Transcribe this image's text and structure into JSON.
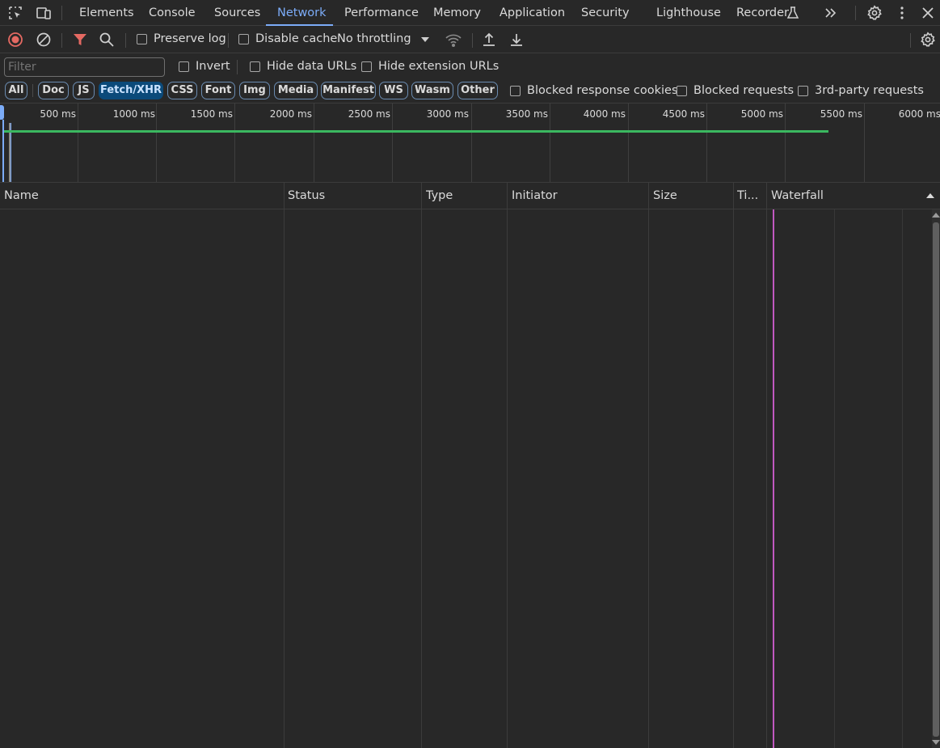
{
  "tabs": [
    {
      "label": "Elements"
    },
    {
      "label": "Console"
    },
    {
      "label": "Sources"
    },
    {
      "label": "Network",
      "active": true
    },
    {
      "label": "Performance"
    },
    {
      "label": "Memory"
    },
    {
      "label": "Application"
    },
    {
      "label": "Security"
    },
    {
      "label": "Lighthouse"
    },
    {
      "label": "Recorder"
    }
  ],
  "toolbar": {
    "preserve_log": "Preserve log",
    "disable_cache": "Disable cache",
    "throttling": "No throttling"
  },
  "filter": {
    "placeholder": "Filter",
    "invert": "Invert",
    "hide_data_urls": "Hide data URLs",
    "hide_extension_urls": "Hide extension URLs"
  },
  "type_filters": [
    {
      "label": "All"
    },
    {
      "label": "Doc"
    },
    {
      "label": "JS"
    },
    {
      "label": "Fetch/XHR",
      "active": true
    },
    {
      "label": "CSS"
    },
    {
      "label": "Font"
    },
    {
      "label": "Img"
    },
    {
      "label": "Media"
    },
    {
      "label": "Manifest"
    },
    {
      "label": "WS"
    },
    {
      "label": "Wasm"
    },
    {
      "label": "Other"
    }
  ],
  "extra_filters": {
    "blocked_cookies": "Blocked response cookies",
    "blocked_requests": "Blocked requests",
    "third_party": "3rd-party requests"
  },
  "overview": {
    "ticks": [
      "500 ms",
      "1000 ms",
      "1500 ms",
      "2000 ms",
      "2500 ms",
      "3000 ms",
      "3500 ms",
      "4000 ms",
      "4500 ms",
      "5000 ms",
      "5500 ms",
      "6000 ms"
    ]
  },
  "columns": {
    "name": "Name",
    "status": "Status",
    "type": "Type",
    "initiator": "Initiator",
    "size": "Size",
    "time": "Ti...",
    "waterfall": "Waterfall"
  },
  "colors": {
    "accent": "#7cacf8",
    "record": "#e46962",
    "filter_active": "#e46962",
    "overview_line": "#3bb860",
    "dom_content_loaded": "#7cacf8",
    "load": "#c058c0"
  },
  "icons": [
    "inspect-element-icon",
    "device-toolbar-icon",
    "more-tabs-icon",
    "settings-icon",
    "kebab-menu-icon",
    "close-icon",
    "record-icon",
    "clear-icon",
    "filter-icon",
    "search-icon",
    "dropdown-arrow-icon",
    "network-conditions-icon",
    "import-har-icon",
    "export-har-icon",
    "network-settings-icon",
    "sort-ascending-icon",
    "flask-icon"
  ]
}
